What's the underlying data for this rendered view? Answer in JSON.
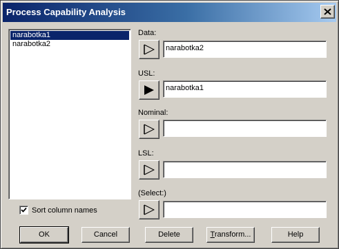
{
  "window": {
    "title": "Process Capability Analysis"
  },
  "column_list": {
    "items": [
      "narabotka1",
      "narabotka2"
    ],
    "selected_index": 0
  },
  "sort_option": {
    "label": "Sort column names",
    "checked": true
  },
  "fields": {
    "data": {
      "label": "Data:",
      "value": "narabotka2"
    },
    "usl": {
      "label": "USL:",
      "value": "narabotka1"
    },
    "nominal": {
      "label": "Nominal:",
      "value": ""
    },
    "lsl": {
      "label": "LSL:",
      "value": ""
    },
    "select": {
      "label": "(Select:)",
      "value": ""
    }
  },
  "buttons": {
    "ok": "OK",
    "cancel": "Cancel",
    "delete": "Delete",
    "transform": "Transform...",
    "help": "Help"
  },
  "icons": {
    "close": "close-icon",
    "arrow_outline": "arrow-right-outline-icon",
    "arrow_filled": "arrow-right-filled-icon",
    "check": "checkmark-icon"
  }
}
